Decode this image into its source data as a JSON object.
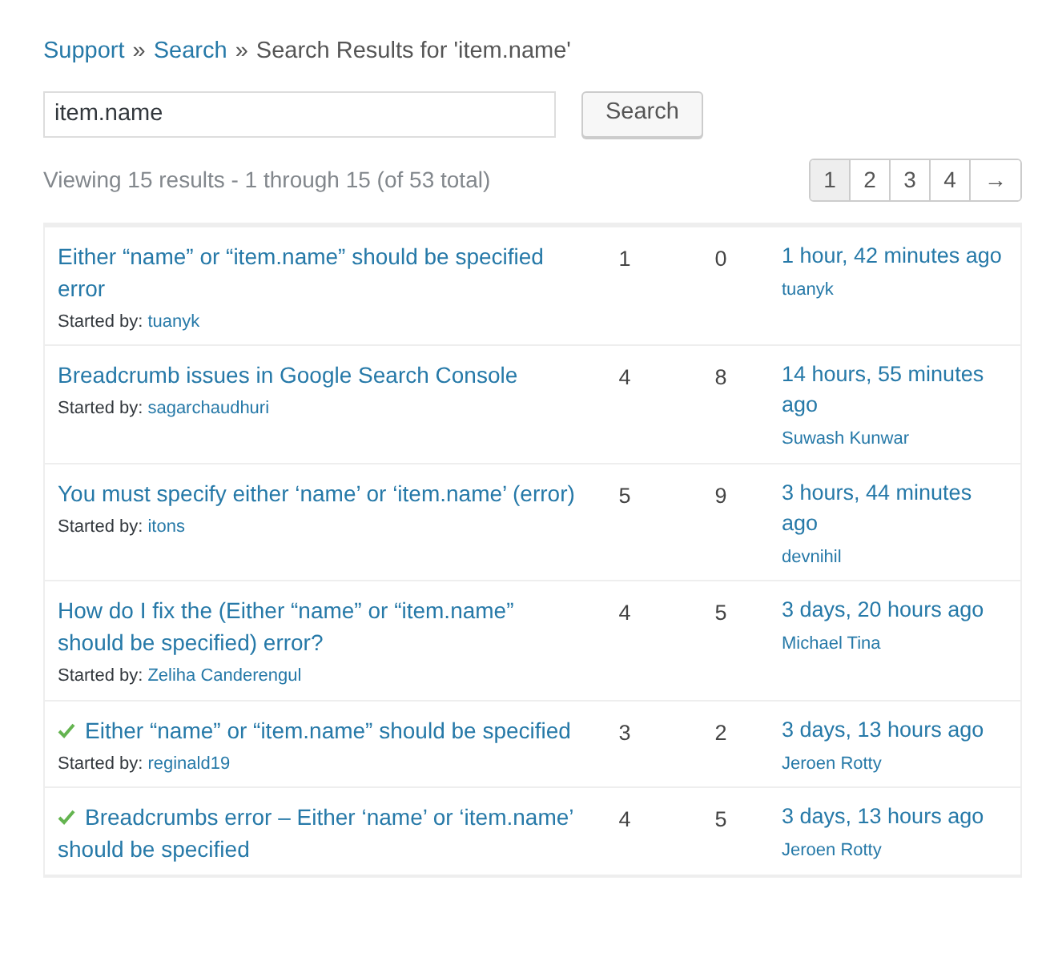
{
  "breadcrumb": [
    {
      "text": "Support",
      "kind": "link"
    },
    {
      "text": "»",
      "kind": "sep"
    },
    {
      "text": "Search",
      "kind": "link"
    },
    {
      "text": "»",
      "kind": "sep"
    },
    {
      "text": "Search Results for 'item.name'",
      "kind": "current"
    }
  ],
  "search": {
    "value": "item.name",
    "button": "Search"
  },
  "summary": "Viewing 15 results - 1 through 15 (of 53 total)",
  "pagination": [
    {
      "label": "1",
      "selected": true
    },
    {
      "label": "2",
      "selected": false
    },
    {
      "label": "3",
      "selected": false
    },
    {
      "label": "4",
      "selected": false
    },
    {
      "label": "→",
      "selected": false
    }
  ],
  "topics": [
    {
      "resolved": false,
      "title": "Either “name” or “item.name” should be specified error",
      "started_label": "Started by:",
      "author": "tuanyk",
      "voices": "1",
      "posts": "0",
      "freshness": "1 hour, 42 minutes ago",
      "last_poster": "tuanyk"
    },
    {
      "resolved": false,
      "title": "Breadcrumb issues in Google Search Console",
      "started_label": "Started by:",
      "author": "sagarchaudhuri",
      "voices": "4",
      "posts": "8",
      "freshness": "14 hours, 55 minutes ago",
      "last_poster": "Suwash Kunwar"
    },
    {
      "resolved": false,
      "title": "You must specify either ‘name’ or ‘item.name’ (error)",
      "started_label": "Started by:",
      "author": "itons",
      "voices": "5",
      "posts": "9",
      "freshness": "3 hours, 44 minutes ago",
      "last_poster": "devnihil"
    },
    {
      "resolved": false,
      "title": "How do I fix the (Either “name” or “item.name” should be specified) error?",
      "started_label": "Started by:",
      "author": "Zeliha Canderengul",
      "voices": "4",
      "posts": "5",
      "freshness": "3 days, 20 hours ago",
      "last_poster": "Michael Tina"
    },
    {
      "resolved": true,
      "title": "Either “name” or “item.name” should be specified",
      "started_label": "Started by:",
      "author": "reginald19",
      "voices": "3",
      "posts": "2",
      "freshness": "3 days, 13 hours ago",
      "last_poster": "Jeroen Rotty"
    },
    {
      "resolved": true,
      "title": "Breadcrumbs error – Either ‘name’ or ‘item.name’ should be specified",
      "voices": "4",
      "posts": "5",
      "freshness": "3 days, 13 hours ago",
      "last_poster": "Jeroen Rotty"
    }
  ]
}
